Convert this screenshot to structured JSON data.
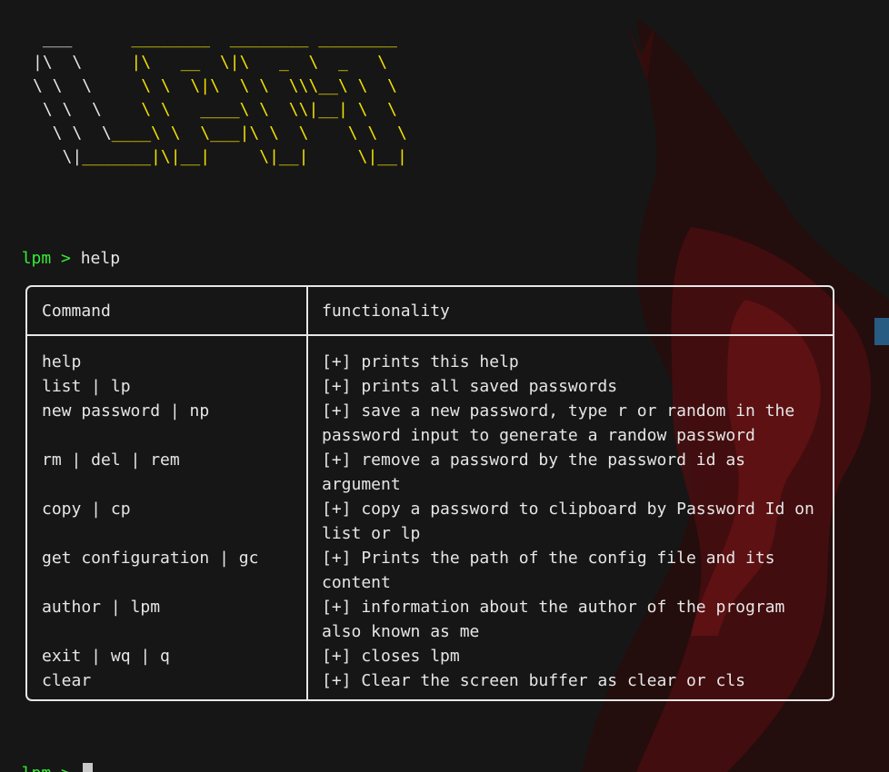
{
  "logo": {
    "lines": [
      {
        "w": " ___      ",
        "y": "________  ________ ________"
      },
      {
        "w": "|\\  \\    ",
        "y": " |\\   __  \\|\\   _  \\  _   \\"
      },
      {
        "w": "\\ \\  \\  ",
        "y": "   \\ \\  \\|\\  \\ \\  \\\\\\__\\ \\  \\"
      },
      {
        "w": " \\ \\  \\ ",
        "y": "   \\ \\   ____\\ \\  \\\\|__| \\  \\"
      },
      {
        "w": "  \\ \\  \\",
        "y": "____\\ \\  \\___|\\ \\  \\    \\ \\  \\"
      },
      {
        "w": "   \\|",
        "y": "_______|\\|__|     \\|__|     \\|__|"
      }
    ]
  },
  "terminal": {
    "prompt": "lpm > ",
    "first_command": "help",
    "second_command": ""
  },
  "help_table": {
    "headers": [
      "Command",
      "functionality"
    ],
    "rows": [
      {
        "command": "help",
        "description": [
          "[+] prints this help"
        ]
      },
      {
        "command": "list | lp",
        "description": [
          "[+] prints all saved passwords"
        ]
      },
      {
        "command": "new password | np",
        "description": [
          "[+] save a new password, type r or random in the",
          "password input to generate a randow password"
        ]
      },
      {
        "command": "rm | del | rem",
        "description": [
          "[+] remove a password by the password id as",
          "argument"
        ]
      },
      {
        "command": "copy | cp",
        "description": [
          "[+] copy a password to clipboard by Password Id on",
          "list or lp"
        ]
      },
      {
        "command": "get configuration | gc",
        "description": [
          "[+] Prints the path of the config file and its",
          "content"
        ]
      },
      {
        "command": "author | lpm",
        "description": [
          "[+] information about the author of the program",
          "also known as me"
        ]
      },
      {
        "command": "exit | wq | q",
        "description": [
          "[+] closes lpm"
        ]
      },
      {
        "command": "clear",
        "description": [
          "[+] Clear the screen buffer as clear or cls"
        ]
      }
    ]
  },
  "colors": {
    "background": "#161616",
    "prompt": "#33ee33",
    "logo_accent": "#f0e000",
    "text": "#e6e6e6"
  }
}
